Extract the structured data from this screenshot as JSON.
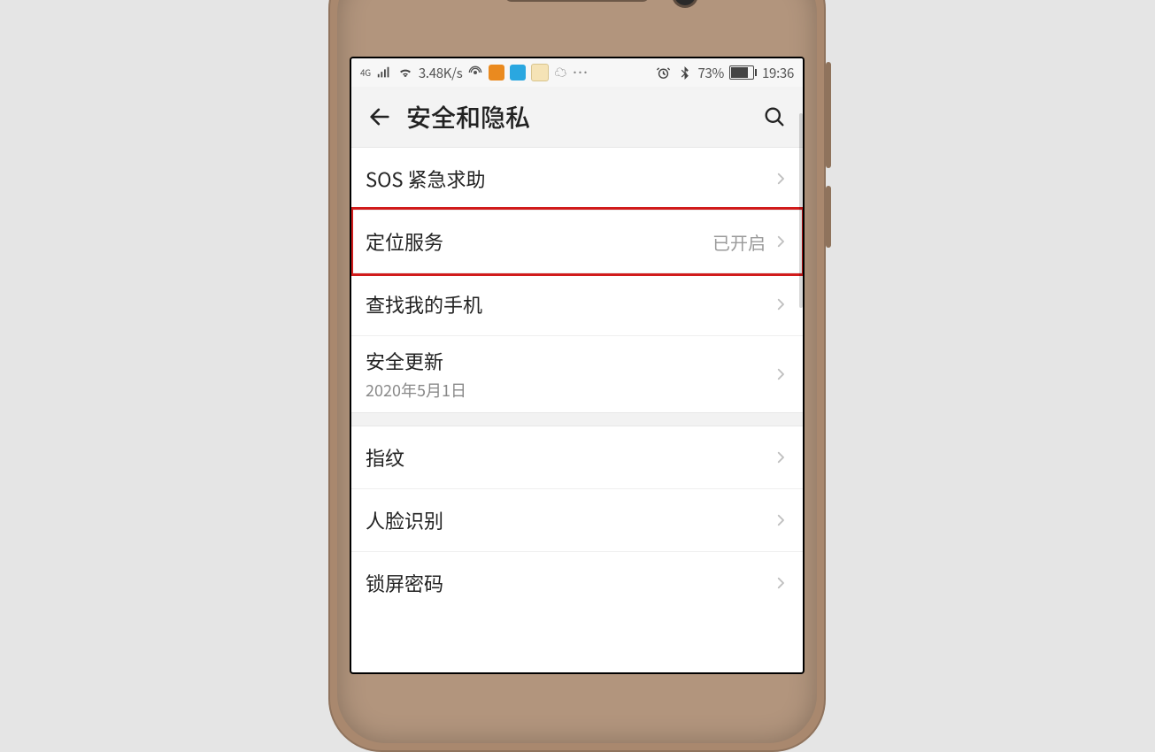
{
  "statusbar": {
    "net_label": "4G",
    "speed": "3.48K/s",
    "battery_pct": "73%",
    "time": "19:36"
  },
  "header": {
    "title": "安全和隐私"
  },
  "rows": {
    "sos": {
      "label": "SOS 紧急求助"
    },
    "location": {
      "label": "定位服务",
      "value": "已开启"
    },
    "findphone": {
      "label": "查找我的手机"
    },
    "secupdate": {
      "label": "安全更新",
      "sub": "2020年5月1日"
    },
    "fingerprint": {
      "label": "指纹"
    },
    "face": {
      "label": "人脸识别"
    },
    "lockpw": {
      "label": "锁屏密码"
    }
  }
}
